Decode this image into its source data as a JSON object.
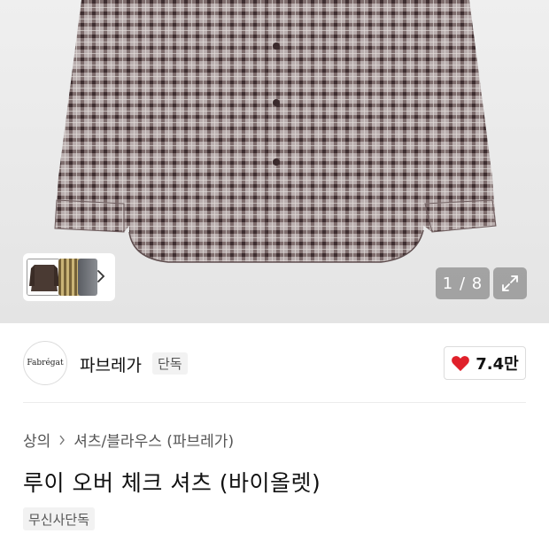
{
  "gallery": {
    "counter": "1 / 8",
    "thumbnails": [
      "brown-check-shirt",
      "yellow-check-shirt",
      "grey-shirt"
    ],
    "icons": {
      "next": "chevron-right-icon",
      "expand": "expand-icon"
    }
  },
  "brand": {
    "logo_text": "Fabrégat",
    "name": "파브레가",
    "badge": "단독",
    "like_icon": "heart-icon",
    "like_count": "7.4만",
    "like_color": "#e0202a"
  },
  "product": {
    "breadcrumb": [
      "상의",
      "셔츠/블라우스 (파브레가)"
    ],
    "title": "루이 오버 체크 셔츠 (바이올렛)",
    "tag": "무신사단독"
  }
}
